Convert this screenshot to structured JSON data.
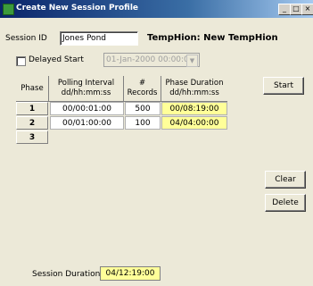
{
  "window": {
    "title": "Create New Session Profile",
    "minimize": "_",
    "maximize": "□",
    "close": "×"
  },
  "session": {
    "id_label": "Session ID",
    "id_value": "Jones Pond",
    "device_label": "TempHion: New TempHion"
  },
  "delayed": {
    "label": "Delayed Start",
    "checked": false,
    "value": "01-Jan-2000 00:00:00",
    "arrow": "▼"
  },
  "table": {
    "headers": [
      "Phase",
      "Polling Interval dd/hh:mm:ss",
      "# Records",
      "Phase Duration dd/hh:mm:ss"
    ],
    "rows": [
      {
        "phase": "1",
        "interval": "00/00:01:00",
        "records": "500",
        "duration": "00/08:19:00"
      },
      {
        "phase": "2",
        "interval": "00/01:00:00",
        "records": "100",
        "duration": "04/04:00:00"
      },
      {
        "phase": "3",
        "interval": "",
        "records": "",
        "duration": ""
      }
    ]
  },
  "buttons": {
    "start": "Start",
    "clear": "Clear",
    "delete": "Delete"
  },
  "footer": {
    "duration_label": "Session Duration",
    "duration_value": "04/12:19:00"
  }
}
